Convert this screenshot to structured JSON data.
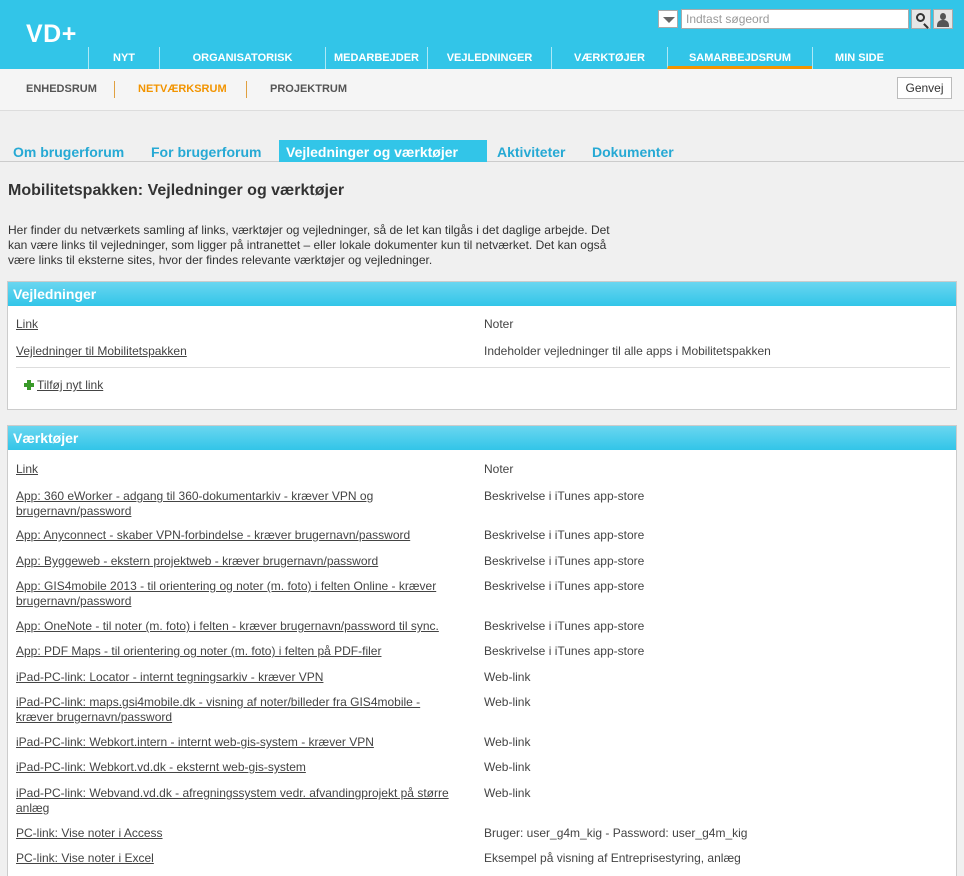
{
  "logo": "VD+",
  "search": {
    "placeholder": "Indtast søgeord"
  },
  "main_nav": [
    "NYT",
    "ORGANISATORISK",
    "MEDARBEJDER",
    "VEJLEDNINGER",
    "VÆRKTØJER",
    "SAMARBEJDSRUM",
    "MIN SIDE"
  ],
  "main_nav_active": "SAMARBEJDSRUM",
  "sub_nav": [
    "ENHEDSRUM",
    "NETVÆRKSRUM",
    "PROJEKTRUM"
  ],
  "sub_nav_active": "NETVÆRKSRUM",
  "genvej_label": "Genvej",
  "tabs": [
    "Om brugerforum",
    "For brugerforum",
    "Vejledninger og værktøjer",
    "Aktiviteter",
    "Dokumenter"
  ],
  "tabs_active": "Vejledninger og værktøjer",
  "page_title": "Mobilitetspakken: Vejledninger og værktøjer",
  "intro_lines": [
    "Her finder du netværkets samling af links, værktøjer og vejledninger, så de let kan tilgås i det daglige arbejde. Det",
    "kan være links til vejledninger, som ligger på intranettet – eller lokale dokumenter kun til netværket. Det kan også",
    "være links til eksterne sites, hvor der findes relevante værktøjer og vejledninger."
  ],
  "panels": {
    "vejledninger": {
      "title": "Vejledninger",
      "col_link": "Link",
      "col_notes": "Noter",
      "rows": [
        {
          "link": [
            "Vejledninger til Mobilitetspakken"
          ],
          "notes": "Indeholder vejledninger til alle apps i Mobilitetspakken"
        }
      ],
      "add_link": "Tilføj nyt link"
    },
    "vaerktojer": {
      "title": "Værktøjer",
      "col_link": "Link",
      "col_notes": "Noter",
      "rows": [
        {
          "link": [
            "App: 360 eWorker - adgang til 360-dokumentarkiv - kræver VPN og",
            "brugernavn/password"
          ],
          "notes": "Beskrivelse i iTunes app-store"
        },
        {
          "link": [
            "App: Anyconnect - skaber VPN-forbindelse - kræver brugernavn/password"
          ],
          "notes": "Beskrivelse i iTunes app-store"
        },
        {
          "link": [
            "App: Byggeweb - ekstern projektweb - kræver brugernavn/password"
          ],
          "notes": "Beskrivelse i iTunes app-store"
        },
        {
          "link": [
            "App: GIS4mobile 2013 - til orientering og noter (m. foto) i felten Online - kræver",
            "brugernavn/password"
          ],
          "notes": "Beskrivelse i iTunes app-store"
        },
        {
          "link": [
            "App: OneNote - til noter (m. foto) i felten - kræver brugernavn/password til sync."
          ],
          "notes": "Beskrivelse i iTunes app-store"
        },
        {
          "link": [
            "App: PDF Maps - til orientering og noter (m. foto) i felten på PDF-filer"
          ],
          "notes": "Beskrivelse i iTunes app-store"
        },
        {
          "link": [
            "iPad-PC-link: Locator - internt tegningsarkiv - kræver VPN"
          ],
          "notes": "Web-link"
        },
        {
          "link": [
            "iPad-PC-link: maps.gsi4mobile.dk - visning af noter/billeder fra GIS4mobile -",
            "kræver brugernavn/password"
          ],
          "notes": "Web-link"
        },
        {
          "link": [
            "iPad-PC-link: Webkort.intern - internt web-gis-system - kræver VPN"
          ],
          "notes": "Web-link"
        },
        {
          "link": [
            "iPad-PC-link: Webkort.vd.dk - eksternt web-gis-system"
          ],
          "notes": "Web-link"
        },
        {
          "link": [
            "iPad-PC-link: Webvand.vd.dk - afregningssystem vedr. afvandingprojekt på større",
            "anlæg"
          ],
          "notes": "Web-link"
        },
        {
          "link": [
            "PC-link: Vise noter i Access"
          ],
          "notes": "Bruger: user_g4m_kig - Password: user_g4m_kig"
        },
        {
          "link": [
            "PC-link: Vise noter i Excel"
          ],
          "notes": "Eksempel på visning af Entreprisestyring, anlæg"
        }
      ]
    }
  },
  "colors": {
    "accent": "#32c5e8",
    "active_orange": "#f29400",
    "tab_text": "#26a9d4"
  }
}
